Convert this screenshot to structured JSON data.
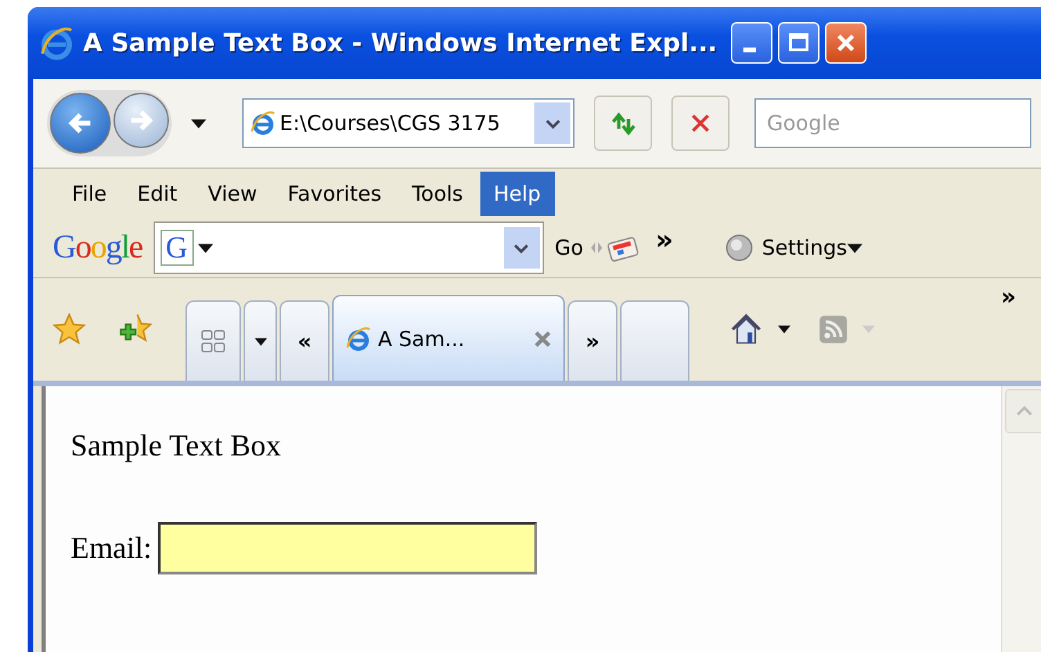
{
  "window": {
    "title": "A Sample Text Box - Windows Internet Expl..."
  },
  "address_bar": {
    "value": "E:\\Courses\\CGS 3175"
  },
  "search": {
    "placeholder": "Google"
  },
  "menu": [
    {
      "label": "File",
      "selected": false
    },
    {
      "label": "Edit",
      "selected": false
    },
    {
      "label": "View",
      "selected": false
    },
    {
      "label": "Favorites",
      "selected": false
    },
    {
      "label": "Tools",
      "selected": false
    },
    {
      "label": "Help",
      "selected": true
    }
  ],
  "google_toolbar": {
    "logo": "Google",
    "search_glyph": "G",
    "go": "Go",
    "more": "»",
    "settings": "Settings"
  },
  "tab_bar": {
    "scroll_left": "«",
    "scroll_right": "»",
    "more": "»",
    "tabs": [
      {
        "label": "A Sam...",
        "selected": true
      }
    ]
  },
  "page": {
    "heading": "Sample Text Box",
    "label": "Email:"
  }
}
